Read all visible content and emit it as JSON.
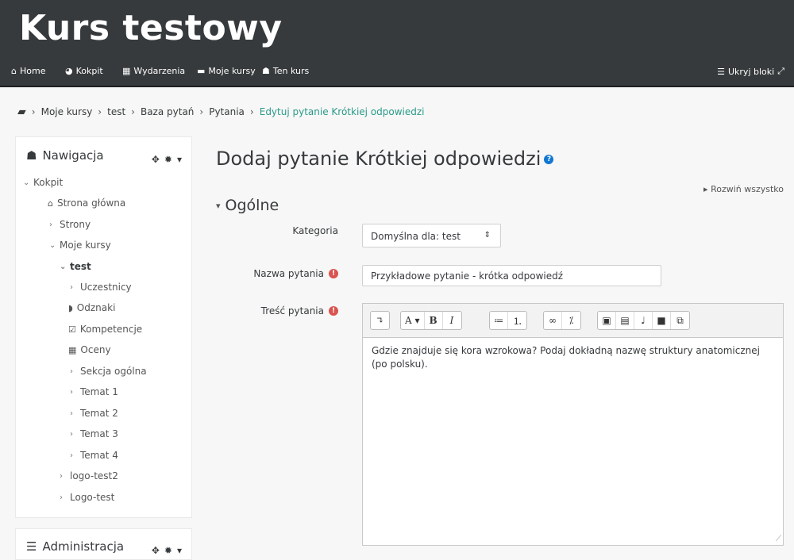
{
  "site_title": "Kurs testowy",
  "navbar": {
    "items": [
      {
        "label": "Home",
        "icon": "home-icon"
      },
      {
        "label": "Kokpit",
        "icon": "dashboard-icon"
      },
      {
        "label": "Wydarzenia",
        "icon": "calendar-icon"
      },
      {
        "label": "Moje kursy",
        "icon": "briefcase-icon"
      },
      {
        "label": "Ten kurs",
        "icon": "sitemap-icon"
      }
    ],
    "hide_blocks_label": "Ukryj bloki"
  },
  "breadcrumb": [
    "Moje kursy",
    "test",
    "Baza pytań",
    "Pytania",
    "Edytuj pytanie Krótkiej odpowiedzi"
  ],
  "nav_block": {
    "title": "Nawigacja",
    "items": [
      {
        "label": "Kokpit"
      },
      {
        "label": "Strona główna"
      },
      {
        "label": "Strony"
      },
      {
        "label": "Moje kursy"
      },
      {
        "label": "test"
      },
      {
        "label": "Uczestnicy"
      },
      {
        "label": "Odznaki"
      },
      {
        "label": "Kompetencje"
      },
      {
        "label": "Oceny"
      },
      {
        "label": "Sekcja ogólna"
      },
      {
        "label": "Temat 1"
      },
      {
        "label": "Temat 2"
      },
      {
        "label": "Temat 3"
      },
      {
        "label": "Temat 4"
      },
      {
        "label": "logo-test2"
      },
      {
        "label": "Logo-test"
      }
    ]
  },
  "admin_block": {
    "title": "Administracja"
  },
  "main": {
    "title": "Dodaj pytanie Krótkiej odpowiedzi",
    "expand_all": "Rozwiń wszystko",
    "section": "Ogólne",
    "category_label": "Kategoria",
    "category_value": "Domyślna dla: test",
    "name_label": "Nazwa pytania",
    "name_value": "Przykładowe pytanie - krótka odpowiedź",
    "text_label": "Treść pytania",
    "text_value": "Gdzie znajduje się kora wzrokowa? Podaj dokładną nazwę struktury anatomicznej (po polsku)."
  },
  "colors": {
    "header_bg": "#373a3c",
    "link_accent": "#2a9a88",
    "required": "#d9534f",
    "help": "#1177d1"
  }
}
